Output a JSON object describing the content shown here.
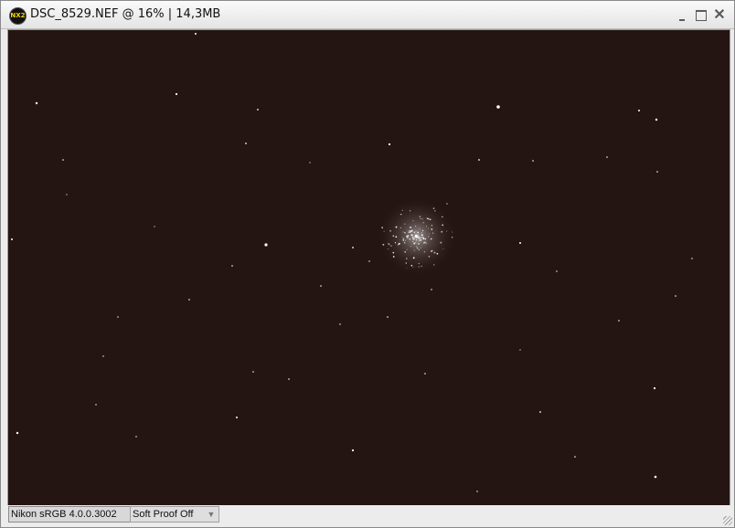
{
  "window": {
    "app_icon_text": "NX2",
    "title": "DSC_8529.NEF @ 16% | 14,3MB",
    "minimize_icon": "minimize-icon",
    "maximize_icon": "maximize-icon",
    "close_icon": "close-icon",
    "close_glyph": "✕"
  },
  "status": {
    "color_profile": "Nikon sRGB 4.0.0.3002",
    "soft_proof": "Soft Proof Off",
    "dropdown_glyph": "▼"
  },
  "image": {
    "background_color": "#251512",
    "star_color": "#ffffff"
  }
}
